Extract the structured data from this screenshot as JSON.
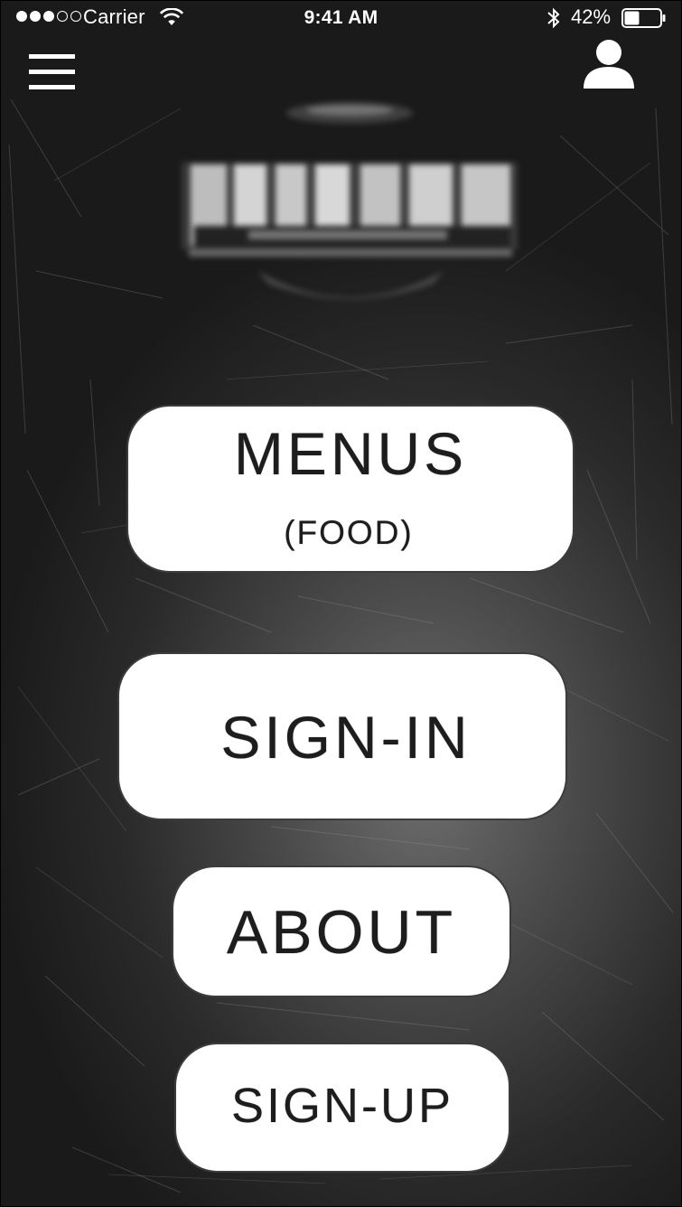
{
  "status_bar": {
    "signal_bars_full": 3,
    "signal_bars_total": 5,
    "carrier": "Carrier",
    "time": "9:41 AM",
    "battery_percent": "42%",
    "battery_level": 0.42,
    "icons": [
      "wifi-icon",
      "bluetooth-icon",
      "battery-icon"
    ]
  },
  "top_nav": {
    "menu_icon": "hamburger-menu-icon",
    "profile_icon": "user-profile-icon"
  },
  "logo": {
    "icon": "restaurant-logo"
  },
  "buttons": {
    "menus": {
      "label": "MENUS",
      "sublabel": "(FOOD)"
    },
    "sign_in": {
      "label": "SIGN-IN"
    },
    "about": {
      "label": "ABOUT"
    },
    "sign_up": {
      "label": "SIGN-UP"
    }
  },
  "colors": {
    "button_background": "#ffffff",
    "button_text": "#1d1d1d",
    "button_border": "#3c3c3c",
    "background_dark": "#1a1a1a",
    "background_light": "#6e6e6e",
    "status_text": "#ffffff"
  }
}
